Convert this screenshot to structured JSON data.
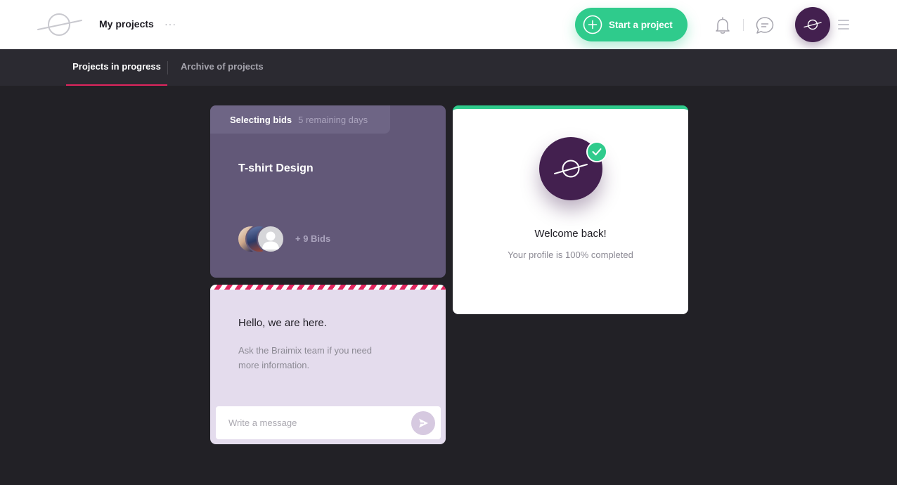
{
  "header": {
    "title": "My projects",
    "more_label": "···",
    "start_button_label": "Start a project"
  },
  "tabs": [
    {
      "label": "Projects in progress",
      "active": true
    },
    {
      "label": "Archive of projects",
      "active": false
    }
  ],
  "project": {
    "status_label": "Selecting bids",
    "status_days": "5 remaining days",
    "title": "T-shirt Design",
    "bids_label": "+ 9 Bids"
  },
  "welcome": {
    "title": "Welcome back!",
    "subtitle": "Your profile is 100% completed",
    "profile_completion": 1.0
  },
  "help": {
    "title": "Hello, we are here.",
    "text": "Ask the Braimix team if you need more information.",
    "input_placeholder": "Write a message"
  },
  "colors": {
    "accent_green": "#2fcb8c",
    "accent_pink": "#e0255e",
    "brand_purple": "#43204f",
    "card_purple": "#625878",
    "background": "#222126"
  },
  "icons": [
    "logo-icon",
    "plus-circle-icon",
    "bell-icon",
    "chat-icon",
    "menu-icon",
    "check-icon",
    "send-icon"
  ]
}
